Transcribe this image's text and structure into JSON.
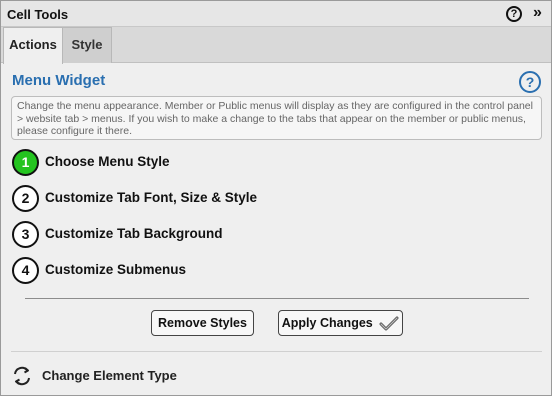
{
  "titlebar": {
    "title": "Cell Tools",
    "help_glyph": "?",
    "collapse_glyph": "»",
    "help_icon": "help-circle-icon",
    "collapse_icon": "double-chevron-right-icon"
  },
  "tabs": [
    {
      "label": "Actions",
      "active": true
    },
    {
      "label": "Style",
      "active": false
    }
  ],
  "widget": {
    "title": "Menu Widget",
    "help_glyph": "?",
    "description": "Change the menu appearance. Member or Public menus will display as they are configured in the control panel > website tab > menus. If you wish to make a change to the tabs that appear on the member or public menus, please configure it there."
  },
  "steps": [
    {
      "number": "1",
      "label": "Choose Menu Style",
      "active": true
    },
    {
      "number": "2",
      "label": "Customize Tab Font, Size & Style",
      "active": false
    },
    {
      "number": "3",
      "label": "Customize Tab Background",
      "active": false
    },
    {
      "number": "4",
      "label": "Customize Submenus",
      "active": false
    }
  ],
  "buttons": {
    "remove_styles": "Remove Styles",
    "apply_changes": "Apply Changes"
  },
  "footer": {
    "change_element_type": "Change Element Type",
    "icon": "refresh-cycle-icon"
  },
  "colors": {
    "accent_blue": "#2a6fb0",
    "active_step_green": "#24c41f",
    "panel_bg": "#efefef"
  }
}
